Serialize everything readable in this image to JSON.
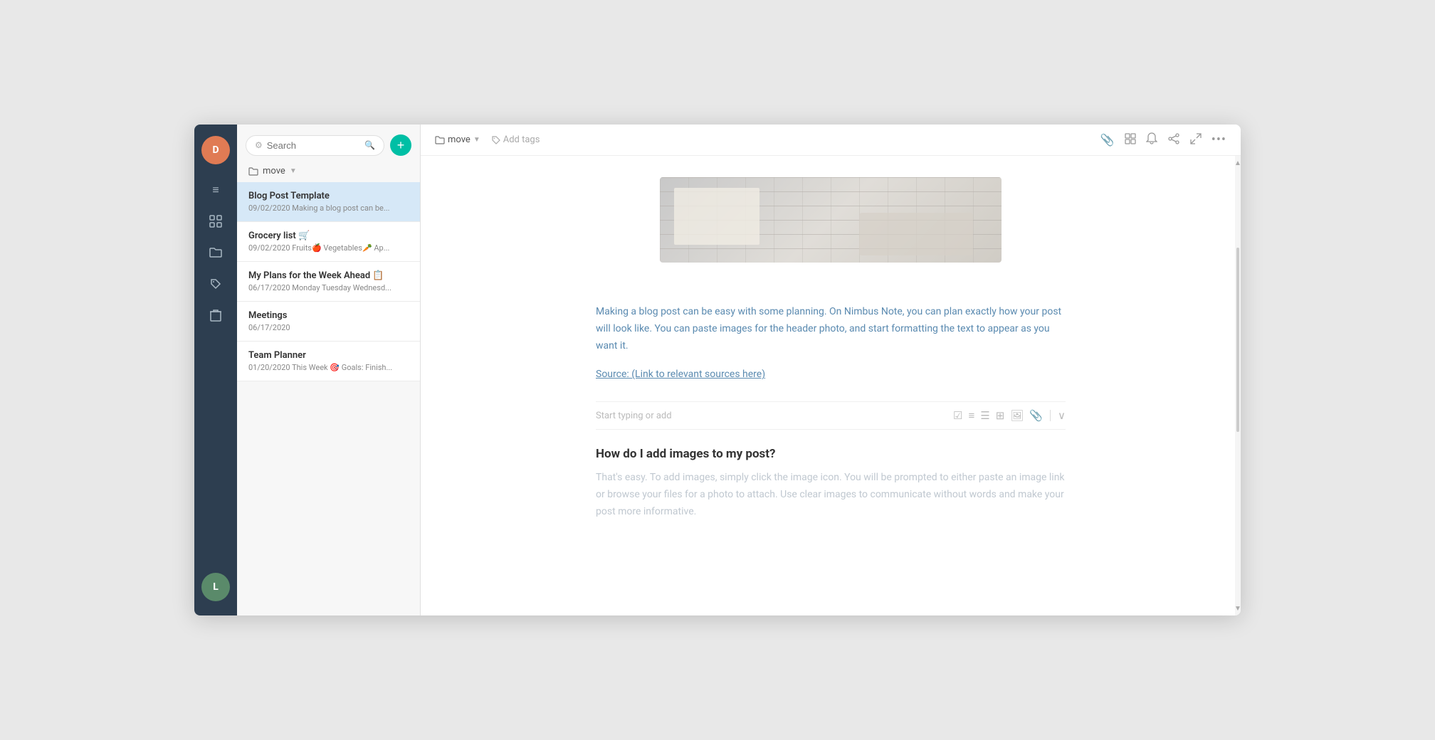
{
  "app": {
    "title": "Nimbus Note"
  },
  "sidebar": {
    "user_initial_top": "D",
    "user_initial_bottom": "L",
    "icons": [
      {
        "name": "menu-icon",
        "symbol": "≡"
      },
      {
        "name": "grid-icon",
        "symbol": "⊞"
      },
      {
        "name": "folder-icon",
        "symbol": "📁"
      },
      {
        "name": "tag-icon",
        "symbol": "🏷"
      },
      {
        "name": "trash-icon",
        "symbol": "🗑"
      }
    ]
  },
  "notes_panel": {
    "search_placeholder": "Search",
    "folder_label": "move",
    "add_button_label": "+",
    "notes": [
      {
        "id": "blog-post-template",
        "title": "Blog Post Template",
        "date": "09/02/2020",
        "preview": "Making a blog post can be...",
        "active": true
      },
      {
        "id": "grocery-list",
        "title": "Grocery list 🛒",
        "date": "09/02/2020",
        "preview": "Fruits🍎 Vegetables🥕 Ap...",
        "active": false
      },
      {
        "id": "my-plans",
        "title": "My Plans for the Week Ahead 📋",
        "date": "06/17/2020",
        "preview": "Monday Tuesday Wednesd...",
        "active": false
      },
      {
        "id": "meetings",
        "title": "Meetings",
        "date": "06/17/2020",
        "preview": "",
        "active": false
      },
      {
        "id": "team-planner",
        "title": "Team Planner",
        "date": "01/20/2020",
        "preview": "This Week 🎯 Goals: Finish...",
        "active": false
      }
    ]
  },
  "toolbar": {
    "folder_name": "move",
    "add_tags_label": "Add tags",
    "icons": {
      "attach": "📎",
      "grid": "⊞",
      "bell": "🔔",
      "share": "👥",
      "expand": "⛶",
      "more": "•••"
    }
  },
  "editor": {
    "paragraph": "Making a blog post can be easy with some planning. On Nimbus Note, you can plan exactly how your post will look like. You can paste images for the header photo, and start formatting the text to appear as you want it.",
    "source_link": "Source: (Link to relevant sources here)",
    "input_placeholder": "Start typing or add",
    "heading": "How do I add images to my post?",
    "subtext": "That's easy. To add images, simply click the image icon. You will be prompted to either paste an image link or browse your files for a photo to attach. Use clear images to communicate without words and make your post more informative."
  }
}
